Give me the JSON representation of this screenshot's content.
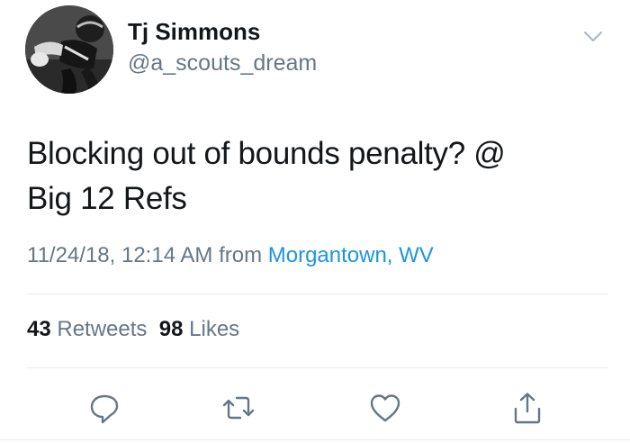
{
  "tweet": {
    "author": {
      "display_name": "Tj Simmons",
      "handle": "@a_scouts_dream",
      "avatar_icon": "football-player-avatar"
    },
    "text_line1": "Blocking out of bounds penalty? @",
    "text_line2": "Big 12 Refs",
    "timestamp": "11/24/18, 12:14 AM",
    "from_label": "from",
    "location": "Morgantown, WV",
    "stats": {
      "retweets_count": "43",
      "retweets_label": "Retweets",
      "likes_count": "98",
      "likes_label": "Likes"
    },
    "actions": [
      "reply-icon",
      "retweet-icon",
      "like-icon",
      "share-icon"
    ]
  },
  "colors": {
    "text_primary": "#14171a",
    "text_secondary": "#657786",
    "link": "#1b95e0",
    "divider": "#e6ecf0"
  }
}
